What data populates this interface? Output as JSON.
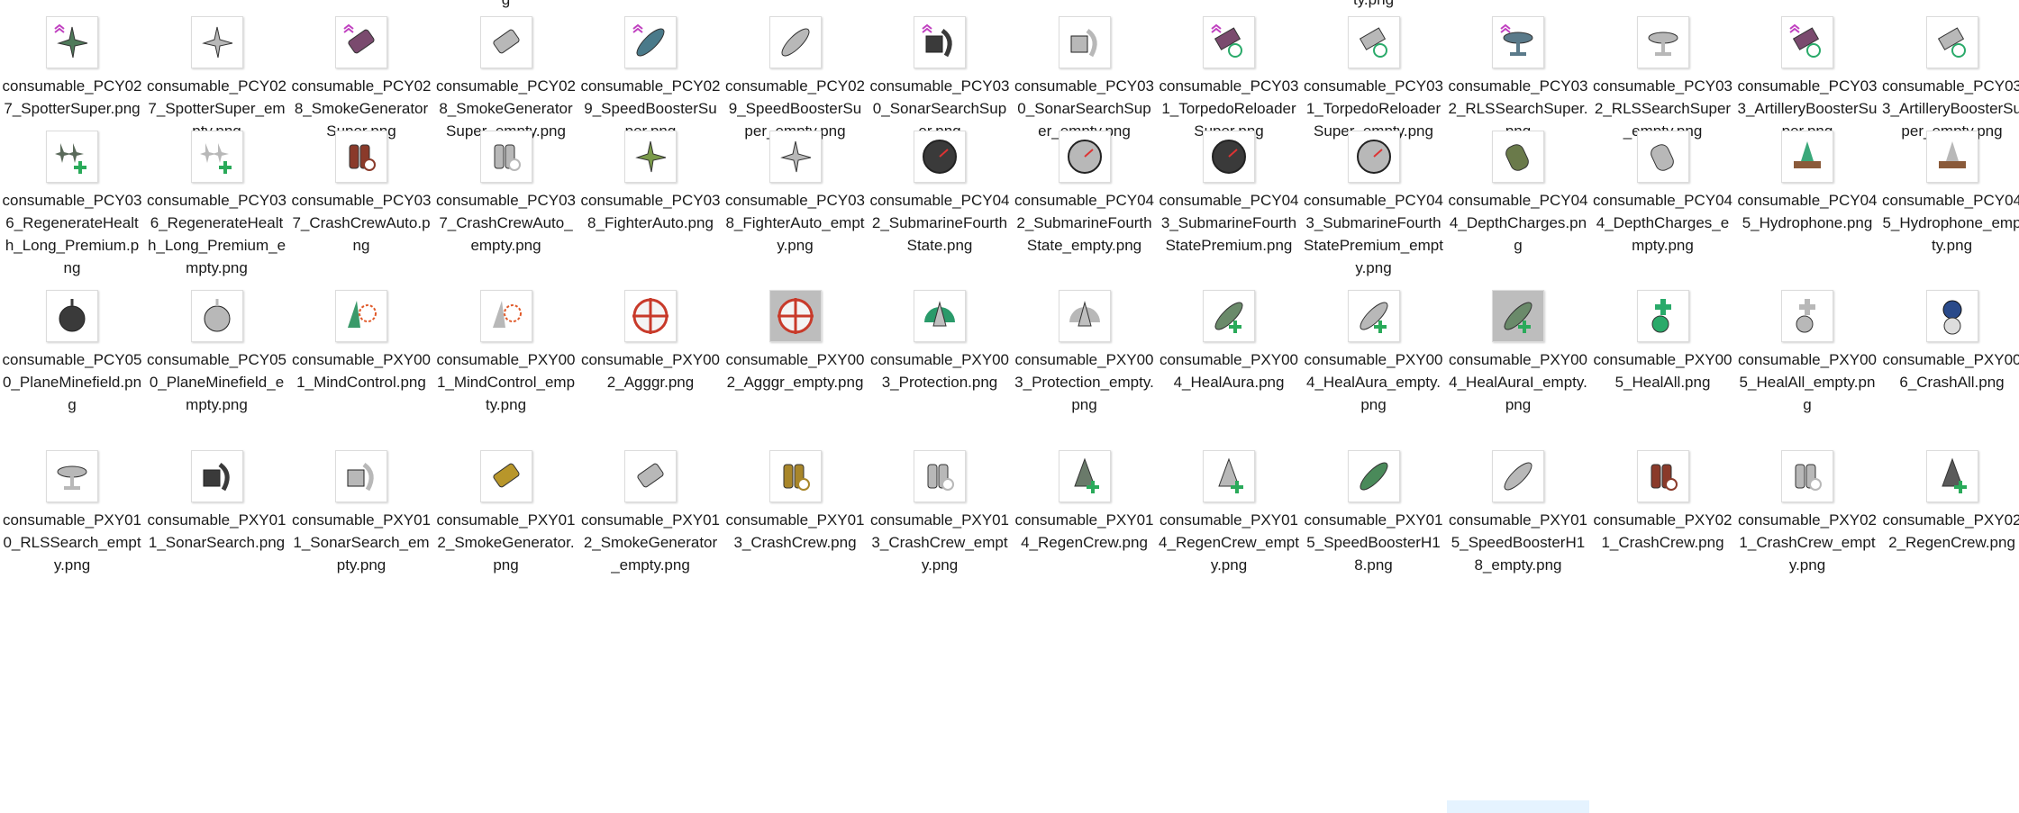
{
  "top_fragments": [
    "g",
    "ty.png"
  ],
  "files": [
    {
      "name": "consumable_PCY027_SpotterSuper.png",
      "icon": "spotter-plane-icon",
      "color": "#4f7a5a",
      "super": true
    },
    {
      "name": "consumable_PCY027_SpotterSuper_empty.png",
      "icon": "spotter-plane-icon",
      "color": "#b8b8b8",
      "super": false
    },
    {
      "name": "consumable_PCY028_SmokeGeneratorSuper.png",
      "icon": "smoke-generator-icon",
      "color": "#7a4a6e",
      "super": true
    },
    {
      "name": "consumable_PCY028_SmokeGeneratorSuper_empty.png",
      "icon": "smoke-generator-icon",
      "color": "#b8b8b8",
      "super": false
    },
    {
      "name": "consumable_PCY029_SpeedBoosterSuper.png",
      "icon": "speed-booster-icon",
      "color": "#4a7a8a",
      "super": true
    },
    {
      "name": "consumable_PCY029_SpeedBoosterSuper_empty.png",
      "icon": "speed-booster-icon",
      "color": "#b8b8b8",
      "super": false
    },
    {
      "name": "consumable_PCY030_SonarSearchSuper.png",
      "icon": "sonar-search-icon",
      "color": "#3a3a3a",
      "super": true
    },
    {
      "name": "consumable_PCY030_SonarSearchSuper_empty.png",
      "icon": "sonar-search-icon",
      "color": "#b8b8b8",
      "super": false
    },
    {
      "name": "consumable_PCY031_TorpedoReloaderSuper.png",
      "icon": "torpedo-reloader-icon",
      "color": "#7a4a6e",
      "super": true
    },
    {
      "name": "consumable_PCY031_TorpedoReloaderSuper_empty.png",
      "icon": "torpedo-reloader-icon",
      "color": "#b8b8b8",
      "super": false
    },
    {
      "name": "consumable_PCY032_RLSSearchSuper.png",
      "icon": "radar-search-icon",
      "color": "#5a7a8a",
      "super": true
    },
    {
      "name": "consumable_PCY032_RLSSearchSuper_empty.png",
      "icon": "radar-search-icon",
      "color": "#b8b8b8",
      "super": false
    },
    {
      "name": "consumable_PCY033_ArtilleryBoosterSuper.png",
      "icon": "artillery-booster-icon",
      "color": "#7a4a6e",
      "super": true
    },
    {
      "name": "consumable_PCY033_ArtilleryBoosterSuper_empty.png",
      "icon": "artillery-booster-icon",
      "color": "#b8b8b8",
      "super": false
    },
    {
      "name": "consumable_PCY036_RegenerateHealth_Long_Premium.png",
      "icon": "planes-heal-icon",
      "color": "#5a6a5a",
      "super": false
    },
    {
      "name": "consumable_PCY036_RegenerateHealth_Long_Premium_empty.png",
      "icon": "planes-heal-icon",
      "color": "#b8b8b8",
      "super": false
    },
    {
      "name": "consumable_PCY037_CrashCrewAuto.png",
      "icon": "crash-crew-icon",
      "color": "#8a3a2a",
      "super": false
    },
    {
      "name": "consumable_PCY037_CrashCrewAuto_empty.png",
      "icon": "crash-crew-icon",
      "color": "#b8b8b8",
      "super": false
    },
    {
      "name": "consumable_PCY038_FighterAuto.png",
      "icon": "fighter-plane-icon",
      "color": "#7a9a4a",
      "super": false
    },
    {
      "name": "consumable_PCY038_FighterAuto_empty.png",
      "icon": "fighter-plane-icon",
      "color": "#b8b8b8",
      "super": false
    },
    {
      "name": "consumable_PCY042_SubmarineFourthState.png",
      "icon": "gauge-icon",
      "color": "#3a3a3a",
      "super": false
    },
    {
      "name": "consumable_PCY042_SubmarineFourthState_empty.png",
      "icon": "gauge-icon",
      "color": "#b8b8b8",
      "super": false
    },
    {
      "name": "consumable_PCY043_SubmarineFourthStatePremium.png",
      "icon": "gauge-icon",
      "color": "#3a3a3a",
      "super": false
    },
    {
      "name": "consumable_PCY043_SubmarineFourthStatePremium_empty.png",
      "icon": "gauge-icon",
      "color": "#b8b8b8",
      "super": false
    },
    {
      "name": "consumable_PCY044_DepthCharges.png",
      "icon": "depth-charge-icon",
      "color": "#6a7a4a",
      "super": false
    },
    {
      "name": "consumable_PCY044_DepthCharges_empty.png",
      "icon": "depth-charge-icon",
      "color": "#b8b8b8",
      "super": false
    },
    {
      "name": "consumable_PCY045_Hydrophone.png",
      "icon": "hydrophone-icon",
      "color": "#3aa87a",
      "super": false
    },
    {
      "name": "consumable_PCY045_Hydrophone_empty.png",
      "icon": "hydrophone-icon",
      "color": "#b8b8b8",
      "super": false
    },
    {
      "name": "consumable_PCY050_PlaneMinefield.png",
      "icon": "mine-icon",
      "color": "#3a3a3a",
      "super": false
    },
    {
      "name": "consumable_PCY050_PlaneMinefield_empty.png",
      "icon": "mine-icon",
      "color": "#b8b8b8",
      "super": false
    },
    {
      "name": "consumable_PXY001_MindControl.png",
      "icon": "mind-control-icon",
      "color": "#3a9a6a",
      "super": false
    },
    {
      "name": "consumable_PXY001_MindControl_empty.png",
      "icon": "mind-control-icon",
      "color": "#b8b8b8",
      "super": false
    },
    {
      "name": "consumable_PXY002_Agggr.png",
      "icon": "crosshair-icon",
      "color": "#c83a2a",
      "super": false
    },
    {
      "name": "consumable_PXY002_Agggr_empty.png",
      "icon": "crosshair-icon",
      "color": "#c83a2a",
      "super": false,
      "dark": true
    },
    {
      "name": "consumable_PXY003_Protection.png",
      "icon": "ship-shield-icon",
      "color": "#2a9a6a",
      "super": false
    },
    {
      "name": "consumable_PXY003_Protection_empty.png",
      "icon": "ship-shield-icon",
      "color": "#b8b8b8",
      "super": false
    },
    {
      "name": "consumable_PXY004_HealAura.png",
      "icon": "heal-aura-icon",
      "color": "#6a8a6a",
      "super": false
    },
    {
      "name": "consumable_PXY004_HealAura_empty.png",
      "icon": "heal-aura-icon",
      "color": "#b8b8b8",
      "super": false
    },
    {
      "name": "consumable_PXY004_HealAuraI_empty.png",
      "icon": "heal-aura-icon",
      "color": "#6a8a6a",
      "super": false,
      "dark": true
    },
    {
      "name": "consumable_PXY005_HealAll.png",
      "icon": "heal-all-icon",
      "color": "#2aaa6a",
      "super": false
    },
    {
      "name": "consumable_PXY005_HealAll_empty.png",
      "icon": "heal-all-icon",
      "color": "#b8b8b8",
      "super": false
    },
    {
      "name": "consumable_PXY006_CrashAll.png",
      "icon": "crash-all-icon",
      "color": "#2a4a8a",
      "super": false
    },
    {
      "name": "consumable_PXY010_RLSSearch_empty.png",
      "icon": "radar-search-icon",
      "color": "#b8b8b8",
      "super": false
    },
    {
      "name": "consumable_PXY011_SonarSearch.png",
      "icon": "sonar-search-icon",
      "color": "#3a3a3a",
      "super": false
    },
    {
      "name": "consumable_PXY011_SonarSearch_empty.png",
      "icon": "sonar-search-icon",
      "color": "#b8b8b8",
      "super": false
    },
    {
      "name": "consumable_PXY012_SmokeGenerator.png",
      "icon": "smoke-generator-icon",
      "color": "#b8962a",
      "super": false
    },
    {
      "name": "consumable_PXY012_SmokeGenerator_empty.png",
      "icon": "smoke-generator-icon",
      "color": "#b8b8b8",
      "super": false
    },
    {
      "name": "consumable_PXY013_CrashCrew.png",
      "icon": "crash-crew-icon",
      "color": "#a8862a",
      "super": false
    },
    {
      "name": "consumable_PXY013_CrashCrew_empty.png",
      "icon": "crash-crew-icon",
      "color": "#b8b8b8",
      "super": false
    },
    {
      "name": "consumable_PXY014_RegenCrew.png",
      "icon": "regen-crew-icon",
      "color": "#6a7a6a",
      "super": false
    },
    {
      "name": "consumable_PXY014_RegenCrew_empty.png",
      "icon": "regen-crew-icon",
      "color": "#b8b8b8",
      "super": false
    },
    {
      "name": "consumable_PXY015_SpeedBoosterH18.png",
      "icon": "speed-booster-icon",
      "color": "#4a8a5a",
      "super": false
    },
    {
      "name": "consumable_PXY015_SpeedBoosterH18_empty.png",
      "icon": "speed-booster-icon",
      "color": "#b8b8b8",
      "super": false
    },
    {
      "name": "consumable_PXY021_CrashCrew.png",
      "icon": "crash-crew-icon",
      "color": "#8a3a2a",
      "super": false
    },
    {
      "name": "consumable_PXY021_CrashCrew_empty.png",
      "icon": "crash-crew-icon",
      "color": "#b8b8b8",
      "super": false
    },
    {
      "name": "consumable_PXY022_RegenCrew.png",
      "icon": "regen-crew-icon",
      "color": "#5a5a5a",
      "super": false
    }
  ]
}
